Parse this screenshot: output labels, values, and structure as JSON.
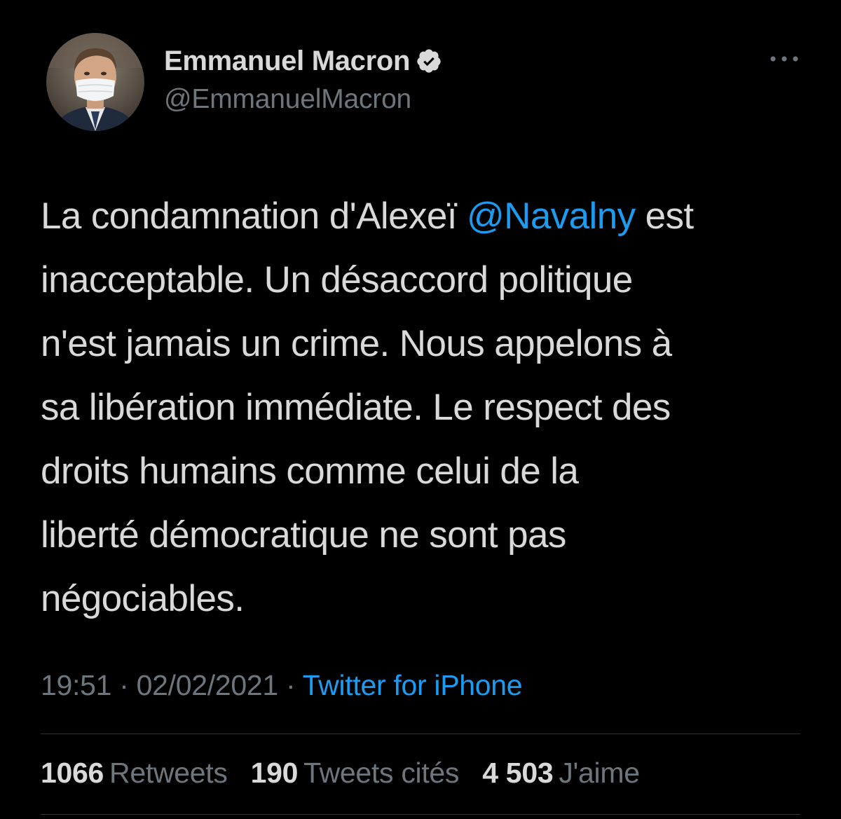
{
  "author": {
    "display_name": "Emmanuel Macron",
    "handle": "@EmmanuelMacron",
    "verified": true,
    "verified_icon": "verified-badge-icon"
  },
  "tweet": {
    "lines": [
      {
        "before": "La condamnation d'Alexeï ",
        "mention": "@Navalny",
        "after": " est"
      },
      {
        "text": "inacceptable. Un désaccord politique"
      },
      {
        "text": "n'est jamais un crime. Nous appelons à"
      },
      {
        "text": "sa libération immédiate. Le respect des"
      },
      {
        "text": "droits humains comme celui de la"
      },
      {
        "text": "liberté démocratique ne sont pas"
      },
      {
        "text": "négociables."
      }
    ]
  },
  "meta": {
    "time": "19:51",
    "separator": " · ",
    "date": "02/02/2021",
    "source": "Twitter for iPhone"
  },
  "stats": {
    "retweets": {
      "count": "1066",
      "label": "Retweets"
    },
    "quotes": {
      "count": "190",
      "label": "Tweets cités"
    },
    "likes": {
      "count": "4 503",
      "label": "J'aime"
    }
  },
  "colors": {
    "background": "#000000",
    "text": "#d9d9d9",
    "secondary": "#6e767d",
    "accent": "#1d9bf0",
    "divider": "#2f3336"
  },
  "icons": {
    "more": "more-horizontal-icon"
  }
}
